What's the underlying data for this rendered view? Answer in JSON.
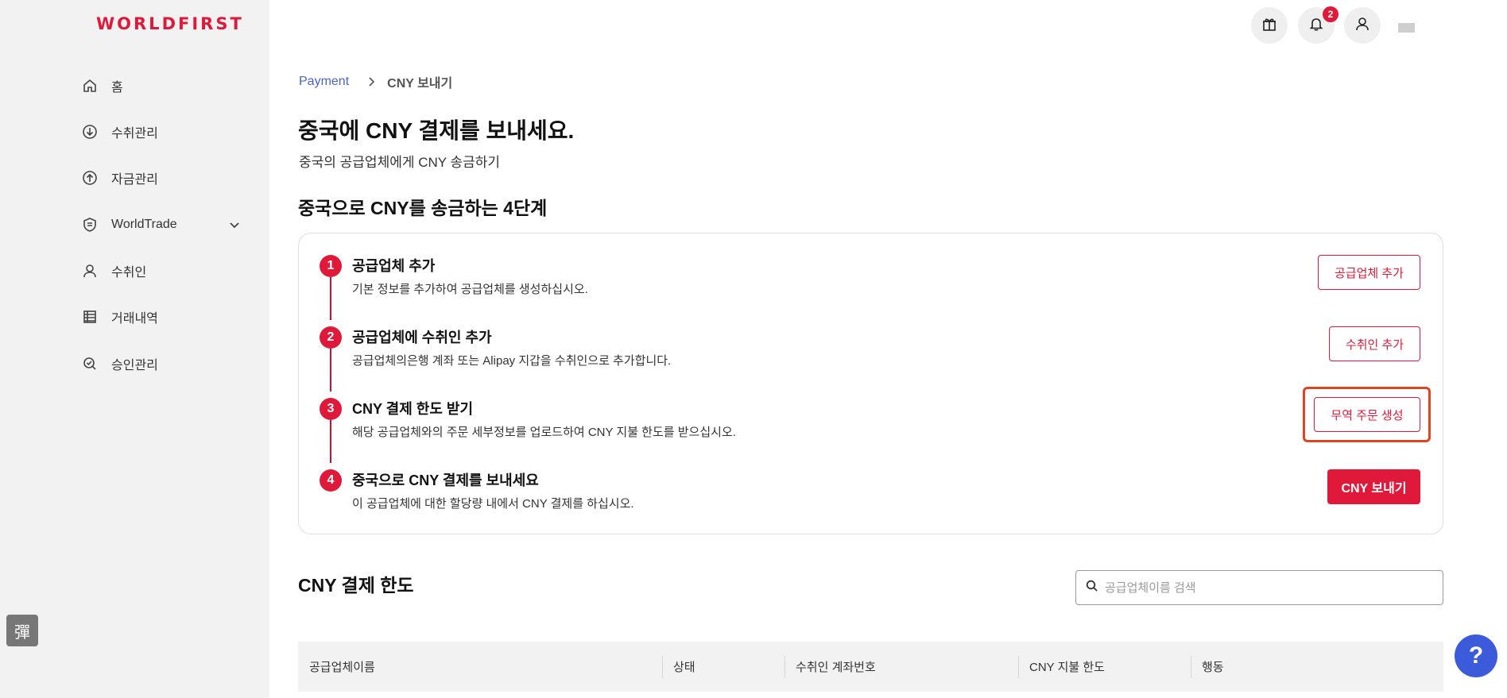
{
  "brand": {
    "logo_text": "WORLDFIRST",
    "accent": "#e0193a"
  },
  "sidebar": {
    "items": [
      {
        "label": "홈",
        "icon": "home-icon"
      },
      {
        "label": "수취관리",
        "icon": "arrow-down-circle-icon"
      },
      {
        "label": "자금관리",
        "icon": "arrow-up-circle-icon"
      },
      {
        "label": "WorldTrade",
        "icon": "shield-icon",
        "expandable": true
      },
      {
        "label": "수취인",
        "icon": "user-icon"
      },
      {
        "label": "거래내역",
        "icon": "table-icon"
      },
      {
        "label": "승인관리",
        "icon": "check-search-icon"
      }
    ]
  },
  "topbar": {
    "gift_icon": "gift-icon",
    "bell_icon": "bell-icon",
    "notification_count": "2",
    "profile_icon": "user-icon"
  },
  "breadcrumb": {
    "parent": "Payment",
    "current": "CNY 보내기"
  },
  "page": {
    "title": "중국에 CNY 결제를 보내세요.",
    "subtitle": "중국의 공급업체에게 CNY 송금하기",
    "steps_heading": "중국으로 CNY를 송금하는 4단계"
  },
  "steps": [
    {
      "num": "1",
      "title": "공급업체 추가",
      "desc": "기본 정보를 추가하여 공급업체를 생성하십시오.",
      "button": "공급업체 추가"
    },
    {
      "num": "2",
      "title": "공급업체에 수취인 추가",
      "desc": "공급업체의은행 계좌 또는 Alipay 지갑을 수취인으로 추가합니다.",
      "button": "수취인 추가"
    },
    {
      "num": "3",
      "title": "CNY 결제 한도 받기",
      "desc": "해당 공급업체와의 주문 세부정보를 업로드하여 CNY 지불 한도를 받으십시오.",
      "button": "무역 주문 생성"
    },
    {
      "num": "4",
      "title": "중국으로 CNY 결제를 보내세요",
      "desc": "이 공급업체에 대한 할당량 내에서 CNY 결제를 하십시오.",
      "button": "CNY 보내기"
    }
  ],
  "limits": {
    "heading": "CNY 결제 한도",
    "search_placeholder": "공급업체이름 검색",
    "columns": [
      "공급업체이름",
      "상태",
      "수취인 계좌번호",
      "CNY 지불 한도",
      "행동"
    ]
  },
  "ime_label": "彈",
  "help_label": "?"
}
